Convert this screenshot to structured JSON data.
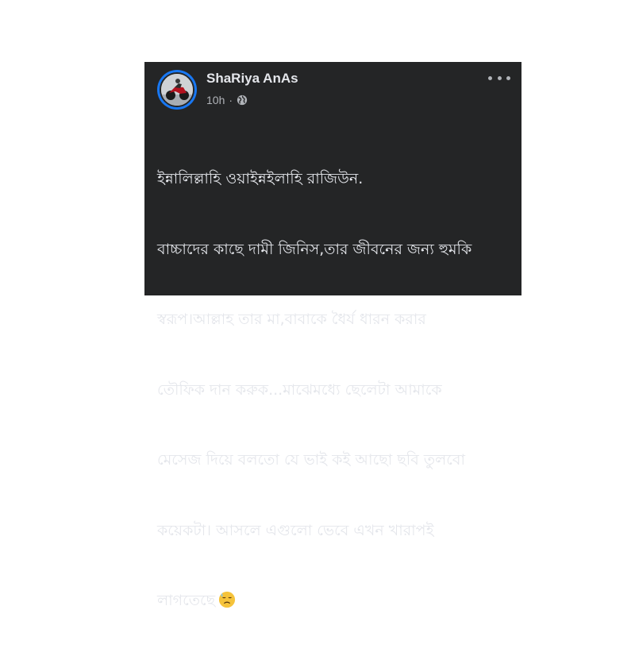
{
  "post": {
    "author": "ShaRiya AnAs",
    "timestamp": "10h",
    "separator": "·",
    "privacy_icon": "globe-icon",
    "more_icon": "more-options-icon",
    "lines": [
      "ইন্নালিল্লাহি ওয়াইন্নইলাহি রাজিউন.",
      "বাচ্চাদের কাছে দামী জিনিস,তার জীবনের জন্য হুমকি",
      "স্বরূপ।আল্লাহ তার মা,বাবাকে ধৈর্য ধারন করার",
      "তৌফিক দান করুক...মাঝেমধ্যে ছেলেটা আমাকে",
      "মেসেজ দিয়ে বলতো যে ভাই কই আছো ছবি তুলবো",
      "কয়েকটা। আসলে এগুলো ভেবে এখন খারাপই",
      "লাগতেছে"
    ],
    "trailing_emoji": "downcast-face-with-sweat-emoji",
    "colors": {
      "card_background": "#242526",
      "text": "#e4e6eb",
      "secondary_text": "#b0b3b8",
      "avatar_ring": "#1877f2"
    }
  }
}
